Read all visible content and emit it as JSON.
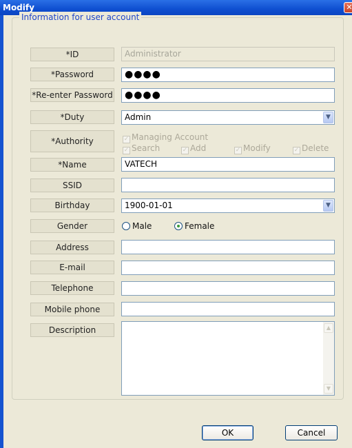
{
  "window": {
    "title": "Modify",
    "close_label": "✕"
  },
  "group": {
    "legend": "Information for user account"
  },
  "fields": {
    "id": {
      "label": "*ID",
      "value": "Administrator"
    },
    "password": {
      "label": "*Password",
      "value": "●●●●"
    },
    "reenter": {
      "label": "*Re-enter Password",
      "value": "●●●●"
    },
    "duty": {
      "label": "*Duty",
      "value": "Admin"
    },
    "authority": {
      "label": "*Authority",
      "managing_account": "Managing Account",
      "search": "Search",
      "add": "Add",
      "modify": "Modify",
      "delete": "Delete"
    },
    "name": {
      "label": "*Name",
      "value": "VATECH"
    },
    "ssid": {
      "label": "SSID",
      "value": ""
    },
    "birthday": {
      "label": "Birthday",
      "value": "1900-01-01"
    },
    "gender": {
      "label": "Gender",
      "male": "Male",
      "female": "Female",
      "selected": "Female"
    },
    "address": {
      "label": "Address",
      "value": ""
    },
    "email": {
      "label": "E-mail",
      "value": ""
    },
    "telephone": {
      "label": "Telephone",
      "value": ""
    },
    "mobile": {
      "label": "Mobile phone",
      "value": ""
    },
    "description": {
      "label": "Description",
      "value": ""
    }
  },
  "buttons": {
    "ok": "OK",
    "cancel": "Cancel"
  },
  "icons": {
    "dropdown": "chevron-down-icon",
    "check": "check-icon",
    "scroll_up": "scroll-up-icon",
    "scroll_down": "scroll-down-icon"
  }
}
